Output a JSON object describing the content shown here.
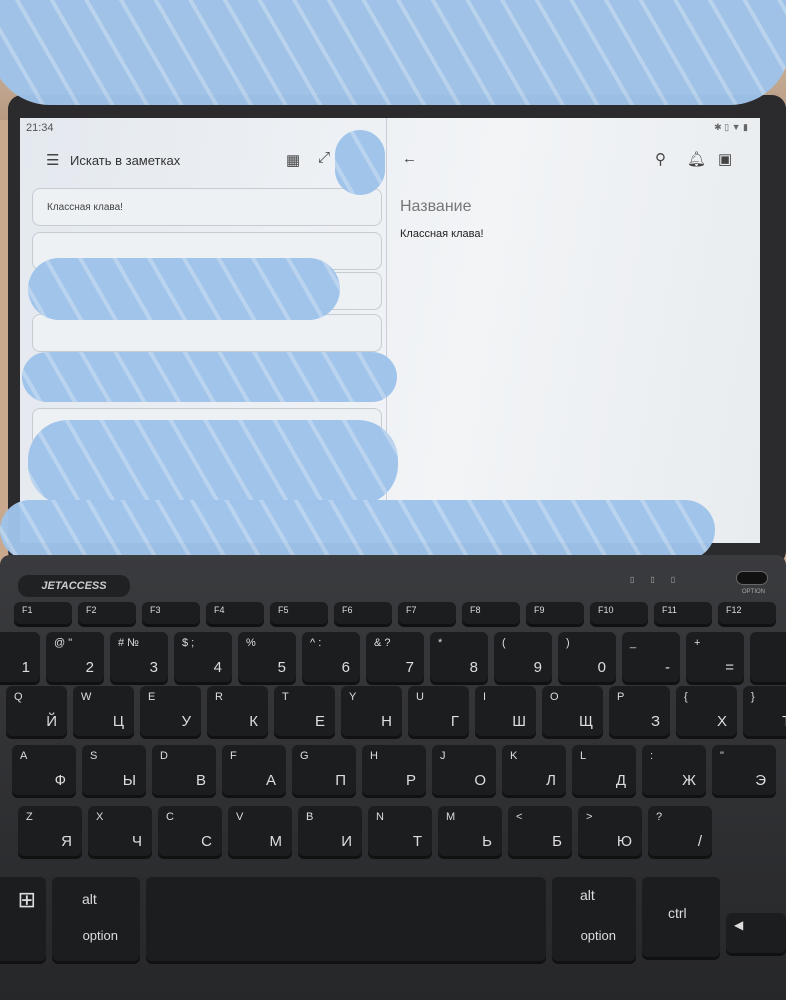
{
  "tablet": {
    "status_time": "21:34",
    "search_placeholder": "Искать в заметках",
    "notes": [
      "Классная клава!"
    ],
    "note_editor": {
      "title_placeholder": "Название",
      "body": "Классная клава!"
    },
    "icons": [
      "menu-icon",
      "grid-view-icon",
      "expand-icon",
      "back-arrow-icon",
      "pin-icon",
      "reminder-icon",
      "archive-icon"
    ]
  },
  "keyboard": {
    "brand": "JETACCESS",
    "option_switch": "OPTION",
    "leds": [
      "bluetooth",
      "A",
      "battery"
    ],
    "f_row": [
      "F1",
      "F2",
      "F3",
      "F4",
      "F5",
      "F6",
      "F7",
      "F8",
      "F9",
      "F10",
      "F11",
      "F12"
    ],
    "rows": [
      [
        [
          "!",
          "1"
        ],
        [
          "@ \"",
          "2"
        ],
        [
          "# №",
          "3"
        ],
        [
          "$ ;",
          "4"
        ],
        [
          "%",
          "5"
        ],
        [
          "^ :",
          "6"
        ],
        [
          "& ?",
          "7"
        ],
        [
          "*",
          "8"
        ],
        [
          "(",
          "9"
        ],
        [
          ")",
          "0"
        ],
        [
          "_",
          "-"
        ],
        [
          "+",
          "="
        ]
      ],
      [
        [
          "Q",
          "Й"
        ],
        [
          "W",
          "Ц"
        ],
        [
          "E",
          "У"
        ],
        [
          "R",
          "К"
        ],
        [
          "T",
          "Е"
        ],
        [
          "Y",
          "Н"
        ],
        [
          "U",
          "Г"
        ],
        [
          "I",
          "Ш"
        ],
        [
          "O",
          "Щ"
        ],
        [
          "P",
          "З"
        ],
        [
          "{",
          "Х"
        ],
        [
          "}",
          "Ъ"
        ]
      ],
      [
        [
          "A",
          "Ф"
        ],
        [
          "S",
          "Ы"
        ],
        [
          "D",
          "В"
        ],
        [
          "F",
          "А"
        ],
        [
          "G",
          "П"
        ],
        [
          "H",
          "Р"
        ],
        [
          "J",
          "О"
        ],
        [
          "K",
          "Л"
        ],
        [
          "L",
          "Д"
        ],
        [
          ":",
          "Ж"
        ],
        [
          "\"",
          "Э"
        ]
      ],
      [
        [
          "Z",
          "Я"
        ],
        [
          "X",
          "Ч"
        ],
        [
          "C",
          "С"
        ],
        [
          "V",
          "М"
        ],
        [
          "B",
          "И"
        ],
        [
          "N",
          "Т"
        ],
        [
          "M",
          "Ь"
        ],
        [
          "<",
          "Б"
        ],
        [
          ">",
          "Ю"
        ],
        [
          "?",
          "/"
        ]
      ]
    ],
    "bottom": {
      "alt": "alt",
      "option": "option",
      "ctrl": "ctrl"
    }
  }
}
